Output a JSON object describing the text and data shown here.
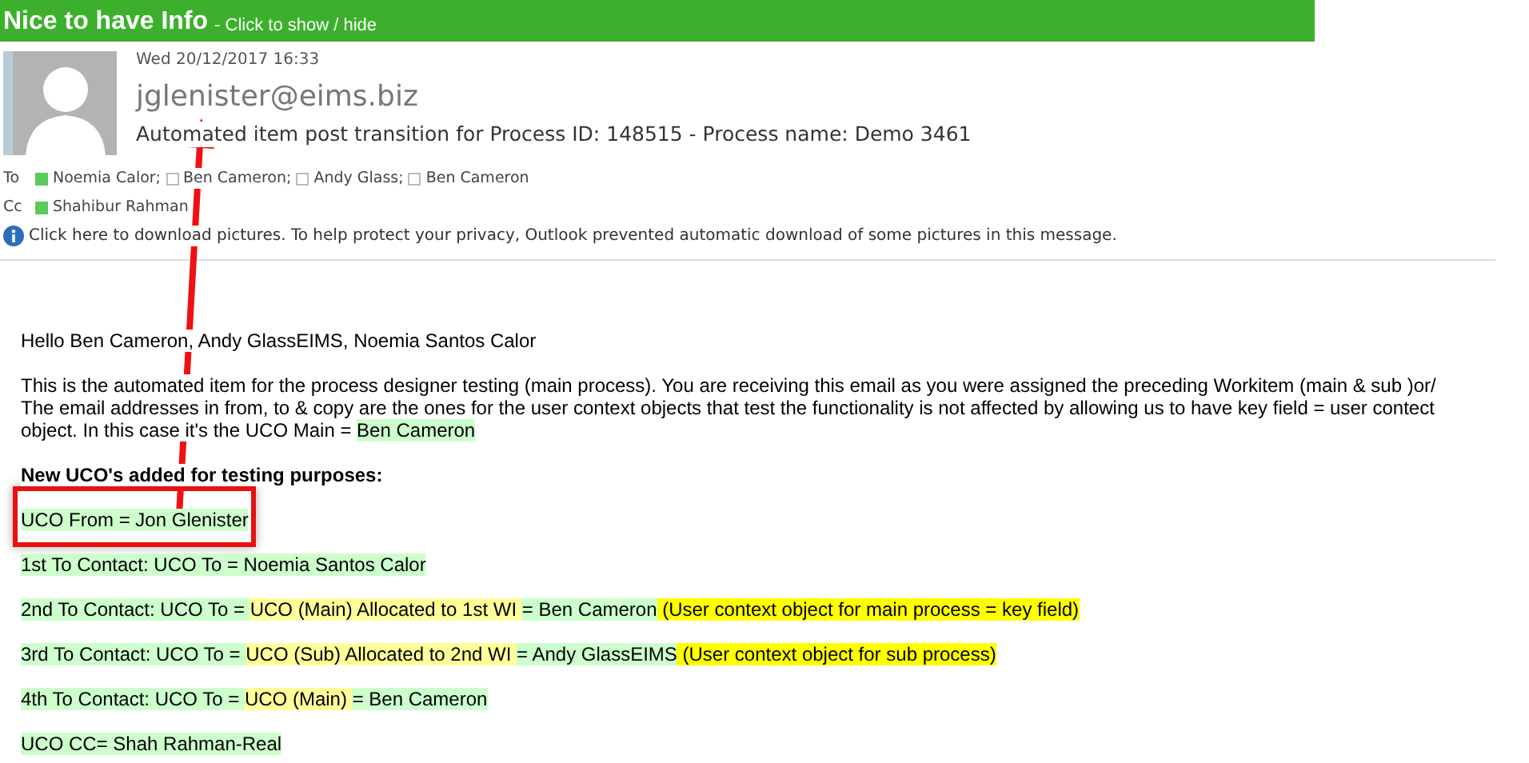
{
  "banner": {
    "title": "Nice to have Info",
    "hint": "- Click to show / hide"
  },
  "message": {
    "date": "Wed 20/12/2017 16:33",
    "sender": "jglenister@eims.biz",
    "subject": "Automated item post transition for Process ID:  148515 - Process name:  Demo 3461",
    "recipients": [
      {
        "label": "To",
        "people": [
          {
            "name": "Noemia Calor;",
            "available": true
          },
          {
            "name": "Ben Cameron;",
            "available": false
          },
          {
            "name": "Andy Glass;",
            "available": false
          },
          {
            "name": "Ben Cameron",
            "available": false
          }
        ]
      },
      {
        "label": "Cc",
        "people": [
          {
            "name": "Shahibur Rahman",
            "available": true
          }
        ]
      }
    ],
    "info": "Click here to download pictures. To help protect your privacy, Outlook prevented automatic download of some pictures in this message."
  },
  "body": [
    {
      "kind": "plain",
      "segments": [
        {
          "text": "Hello Ben Cameron, Andy GlassEIMS, Noemia Santos Calor"
        }
      ]
    },
    {
      "kind": "plain",
      "segments": [
        {
          "text": "This is the automated item for the process designer testing (main process). You are receiving this email as you were assigned the preceding Workitem (main & sub )or/ The email addresses in from, to & copy are the ones for the user context objects that test the functionality is not affected by allowing us to have key field = user contect object. In this case it's the UCO Main = "
        },
        {
          "text": "Ben Cameron",
          "color": "#ccffcc"
        }
      ]
    },
    {
      "kind": "bold",
      "segments": [
        {
          "text": "New UCO's added for testing purposes:"
        }
      ]
    },
    {
      "kind": "plain",
      "segments": [
        {
          "text": "UCO From = Jon Glenister",
          "color": "#ccffcc"
        }
      ]
    },
    {
      "kind": "plain",
      "segments": [
        {
          "text": "1st To Contact: UCO To = Noemia Santos Calor",
          "color": "#ccffcc"
        }
      ]
    },
    {
      "kind": "plain",
      "segments": [
        {
          "text": "2nd To Contact: UCO To = ",
          "color": "#ccffcc"
        },
        {
          "text": "UCO (Main) Allocated to 1st WI ",
          "color": "#ffff99"
        },
        {
          "text": "= Ben Cameron",
          "color": "#ccffcc"
        },
        {
          "text": " (User context object for main process = key field)",
          "color": "#ffff00"
        }
      ]
    },
    {
      "kind": "plain",
      "segments": [
        {
          "text": "3rd To Contact: UCO To = ",
          "color": "#ccffcc"
        },
        {
          "text": "UCO (Sub) Allocated to 2nd WI ",
          "color": "#ffff99"
        },
        {
          "text": "= Andy GlassEIMS",
          "color": "#ccffcc"
        },
        {
          "text": " (User context object for sub process)",
          "color": "#ffff00"
        }
      ]
    },
    {
      "kind": "plain",
      "segments": [
        {
          "text": "4th To Contact: UCO To = ",
          "color": "#ccffcc"
        },
        {
          "text": "UCO (Main) ",
          "color": "#ffff99"
        },
        {
          "text": "= Ben Cameron",
          "color": "#ccffcc"
        }
      ]
    },
    {
      "kind": "plain",
      "segments": [
        {
          "text": "UCO CC= Shah Rahman-Real",
          "color": "#ccffcc"
        }
      ]
    }
  ]
}
